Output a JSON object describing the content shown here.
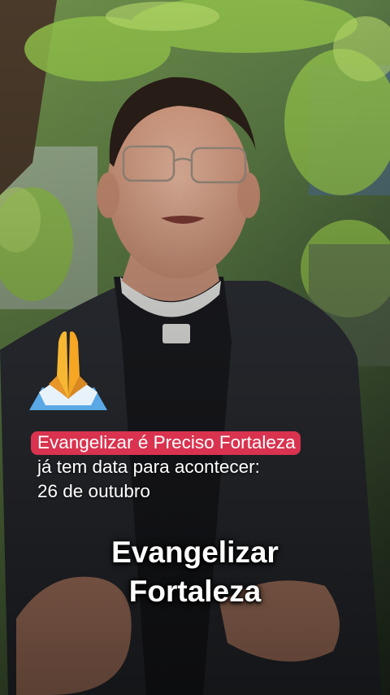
{
  "scene": {
    "description_icon": "man-in-clerical-collar-talking-photo",
    "emoji_icon": "folded-hands-icon"
  },
  "caption": {
    "highlight": "Evangelizar é Preciso Fortaleza",
    "line2": "já tem data para acontecer:",
    "line3": "26 de outubro"
  },
  "subtitle": {
    "line1": "Evangelizar",
    "line2": "Fortaleza"
  },
  "colors": {
    "highlight_bg": "#d9334f",
    "text": "#ffffff"
  }
}
